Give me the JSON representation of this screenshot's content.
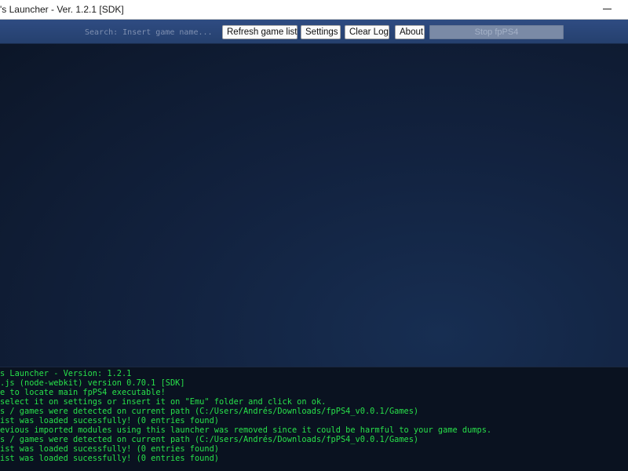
{
  "window": {
    "title": "'s Launcher - Ver. 1.2.1 [SDK]"
  },
  "toolbar": {
    "search_placeholder": "Search: Insert game name...",
    "refresh_label": "Refresh game list",
    "settings_label": "Settings",
    "clear_log_label": "Clear Log",
    "about_label": "About",
    "stop_label": "Stop fpPS4"
  },
  "log": {
    "lines": [
      "s Launcher - Version: 1.2.1",
      ".js (node-webkit) version 0.70.1 [SDK]",
      "e to locate main fpPS4 executable!",
      "select it on settings or insert it on \"Emu\" folder and click on ok.",
      "s / games were detected on current path (C:/Users/Andrés/Downloads/fpPS4_v0.0.1/Games)",
      "ist was loaded sucessfully! (0 entries found)",
      "evious imported modules using this launcher was removed since it could be harmful to your game dumps.",
      "s / games were detected on current path (C:/Users/Andrés/Downloads/fpPS4_v0.0.1/Games)",
      "ist was loaded sucessfully! (0 entries found)",
      "ist was loaded sucessfully! (0 entries found)"
    ]
  },
  "colors": {
    "log_text": "#28e04a",
    "toolbar_bg": "#2b4779",
    "background": "#0d1a2e"
  }
}
